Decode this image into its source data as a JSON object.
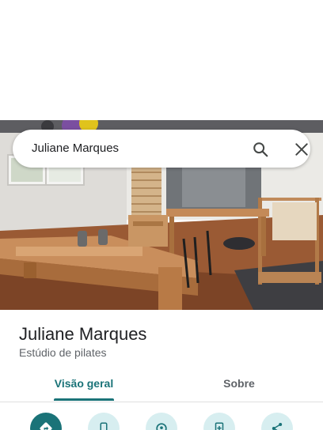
{
  "search": {
    "query": "Juliane Marques"
  },
  "place": {
    "name": "Juliane Marques",
    "category": "Estúdio de pilates"
  },
  "tabs": [
    {
      "label": "Visão geral",
      "selected": true
    },
    {
      "label": "Sobre",
      "selected": false
    }
  ],
  "actions": [
    {
      "icon": "directions-icon"
    },
    {
      "icon": "phone-icon"
    },
    {
      "icon": "save-location-icon"
    },
    {
      "icon": "add-document-icon"
    },
    {
      "icon": "share-icon"
    }
  ],
  "colors": {
    "accent": "#1a7378",
    "accent_light": "#d7eef0",
    "text_primary": "#202124",
    "text_secondary": "#5f6368"
  }
}
